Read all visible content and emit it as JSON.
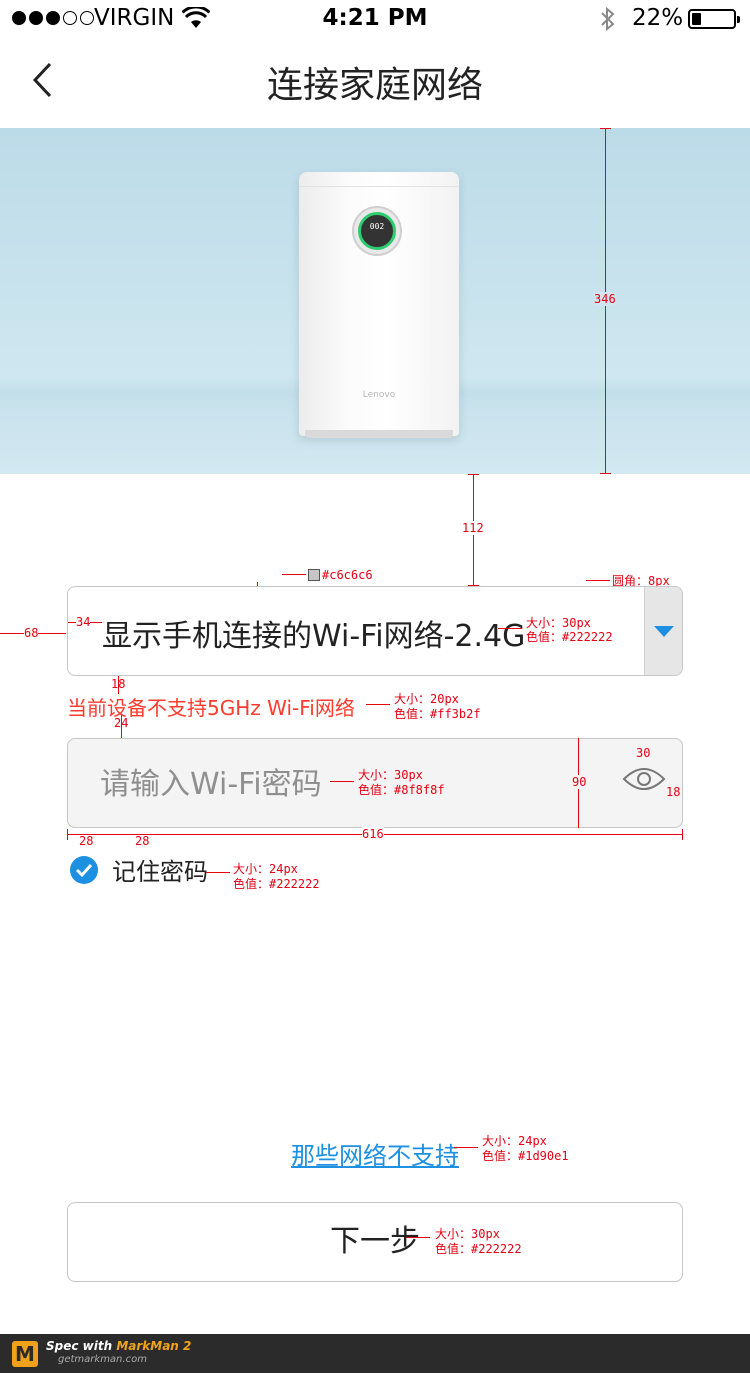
{
  "status_bar": {
    "carrier": "VIRGIN",
    "time": "4:21 PM",
    "battery": "22%",
    "battery_level": 0.22
  },
  "nav": {
    "title": "连接家庭网络"
  },
  "hero": {
    "device_display": "002",
    "device_brand": "Lenovo"
  },
  "wifi_select": {
    "value": "显示手机连接的Wi-Fi网络-2.4G"
  },
  "warning": "当前设备不支持5GHz Wi-Fi网络",
  "password": {
    "placeholder": "请输入Wi-Fi密码"
  },
  "remember": {
    "label": "记住密码",
    "checked": true
  },
  "unsupported_link": "那些网络不支持",
  "next_button": "下一步",
  "colors": {
    "border": "#c6c6c6",
    "text": "#222222",
    "warning": "#ff3b2f",
    "placeholder": "#8f8f8f",
    "link": "#1d90e1"
  },
  "annotations": {
    "border_color": "#c6c6c6",
    "radius": "圆角：8px",
    "select_size": "大小：30px",
    "select_color": "色值：#222222",
    "warn_size": "大小：20px",
    "warn_color": "色值：#ff3b2f",
    "pwd_size": "大小：30px",
    "pwd_color": "色值：#8f8f8f",
    "remember_size": "大小：24px",
    "remember_color": "色值：#222222",
    "link_size": "大小：24px",
    "link_color": "色值：#1d90e1",
    "btn_size": "大小：30px",
    "btn_color": "色值：#222222",
    "dims": [
      "346",
      "112",
      "30",
      "1",
      "34",
      "68",
      "18",
      "24",
      "90",
      "30",
      "18",
      "28",
      "28",
      "616"
    ]
  },
  "footer": {
    "brand": "Spec with",
    "product": "MarkMan 2",
    "url": "getmarkman.com"
  }
}
